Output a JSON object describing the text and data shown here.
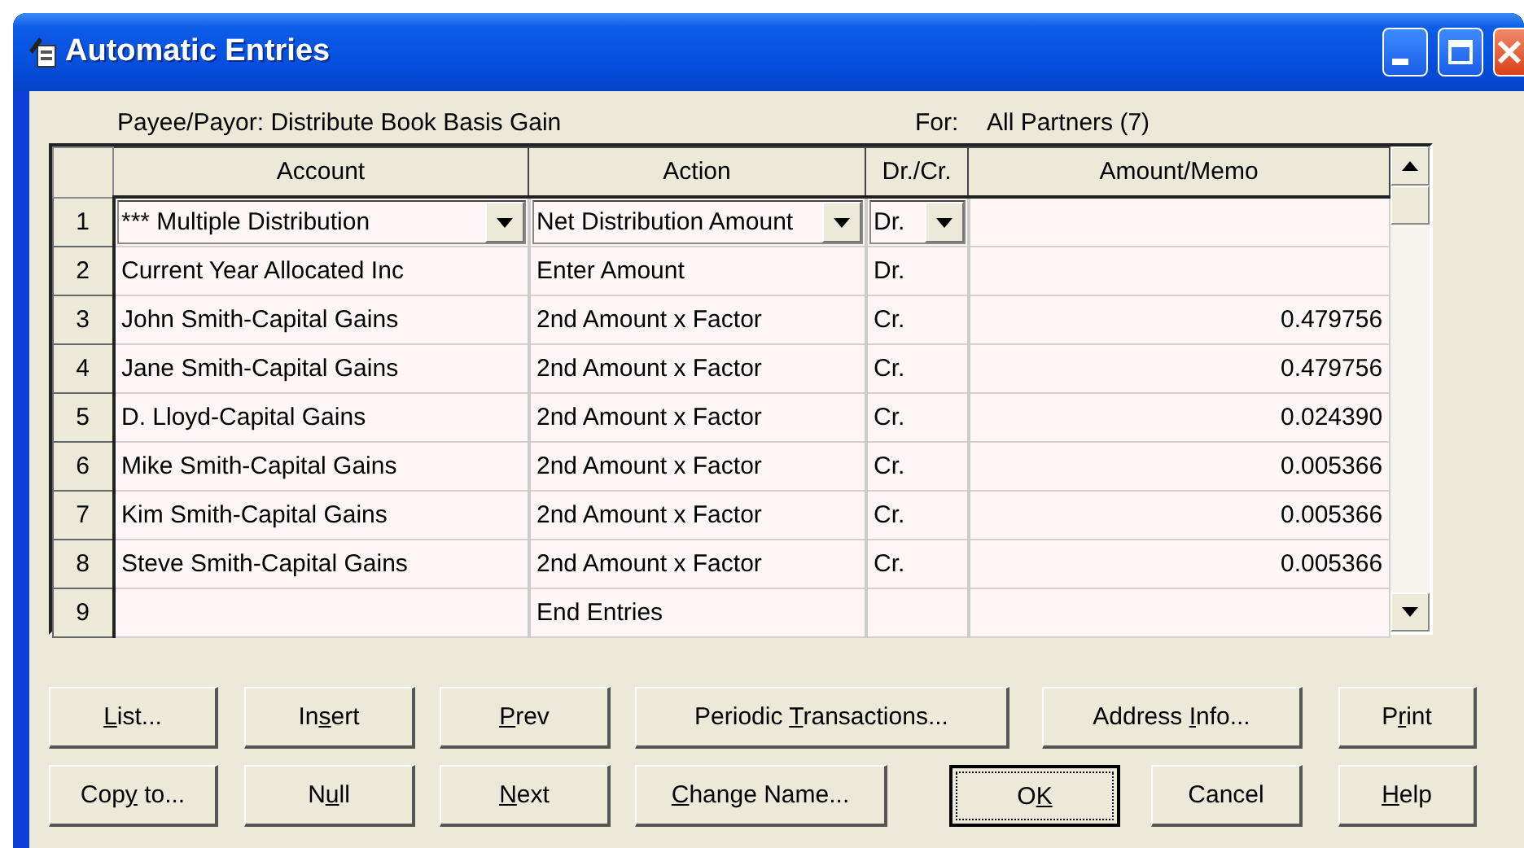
{
  "window": {
    "title": "Automatic Entries"
  },
  "header": {
    "payee_label": "Payee/Payor:",
    "payee_value": "Distribute Book Basis Gain",
    "for_label": "For:",
    "for_value": "All Partners (7)"
  },
  "table": {
    "columns": [
      "Account",
      "Action",
      "Dr./Cr.",
      "Amount/Memo"
    ],
    "rows": [
      {
        "number": "1",
        "account": "*** Multiple Distribution",
        "action": "Net Distribution Amount",
        "dr_cr": "Dr.",
        "selected": true
      },
      {
        "number": "2",
        "account": "Current Year Allocated Inc",
        "action": "Enter Amount",
        "dr_cr": "Dr.",
        "selected": false
      },
      {
        "number": "3",
        "account": "John Smith-Capital Gains",
        "action": "2nd Amount x Factor",
        "dr_cr": "Cr.",
        "amount_memo": "0.479756",
        "selected": false
      },
      {
        "number": "4",
        "account": "Jane Smith-Capital Gains",
        "action": "2nd Amount x Factor",
        "dr_cr": "Cr.",
        "amount_memo": "0.479756",
        "selected": false
      },
      {
        "number": "5",
        "account": "D. Lloyd-Capital Gains",
        "action": "2nd Amount x Factor",
        "dr_cr": "Cr.",
        "amount_memo": "0.024390",
        "selected": false
      },
      {
        "number": "6",
        "account": "Mike Smith-Capital Gains",
        "action": "2nd Amount x Factor",
        "dr_cr": "Cr.",
        "amount_memo": "0.005366",
        "selected": false
      },
      {
        "number": "7",
        "account": "Kim Smith-Capital Gains",
        "action": "2nd Amount x Factor",
        "dr_cr": "Cr.",
        "amount_memo": "0.005366",
        "selected": false
      },
      {
        "number": "8",
        "account": "Steve Smith-Capital Gains",
        "action": "2nd Amount x Factor",
        "dr_cr": "Cr.",
        "amount_memo": "0.005366",
        "selected": false
      },
      {
        "number": "9",
        "action": "End Entries",
        "selected": false
      }
    ]
  },
  "buttons": [
    [
      {
        "key": "L",
        "after": "ist...",
        "focused": false
      },
      {
        "before": "In",
        "key": "s",
        "after": "ert",
        "focused": false
      },
      {
        "key": "P",
        "after": "rev",
        "focused": false
      },
      {
        "before": "Periodic ",
        "key": "T",
        "after": "ransactions...",
        "focused": false
      },
      {
        "before": "Address ",
        "key": "I",
        "after": "nfo...",
        "focused": false
      },
      {
        "before": "P",
        "key": "r",
        "after": "int",
        "focused": false
      }
    ],
    [
      {
        "before": "Cop",
        "key": "y",
        "after": " to...",
        "focused": false
      },
      {
        "before": "N",
        "key": "u",
        "after": "ll",
        "focused": false
      },
      {
        "key": "N",
        "after": "ext",
        "focused": false
      },
      {
        "key": "C",
        "after": "hange Name...",
        "focused": false
      },
      {
        "before": "O",
        "key": "K",
        "focused": true
      },
      {
        "before": "Cancel",
        "focused": false
      },
      {
        "key": "H",
        "after": "elp",
        "focused": false
      }
    ]
  ]
}
